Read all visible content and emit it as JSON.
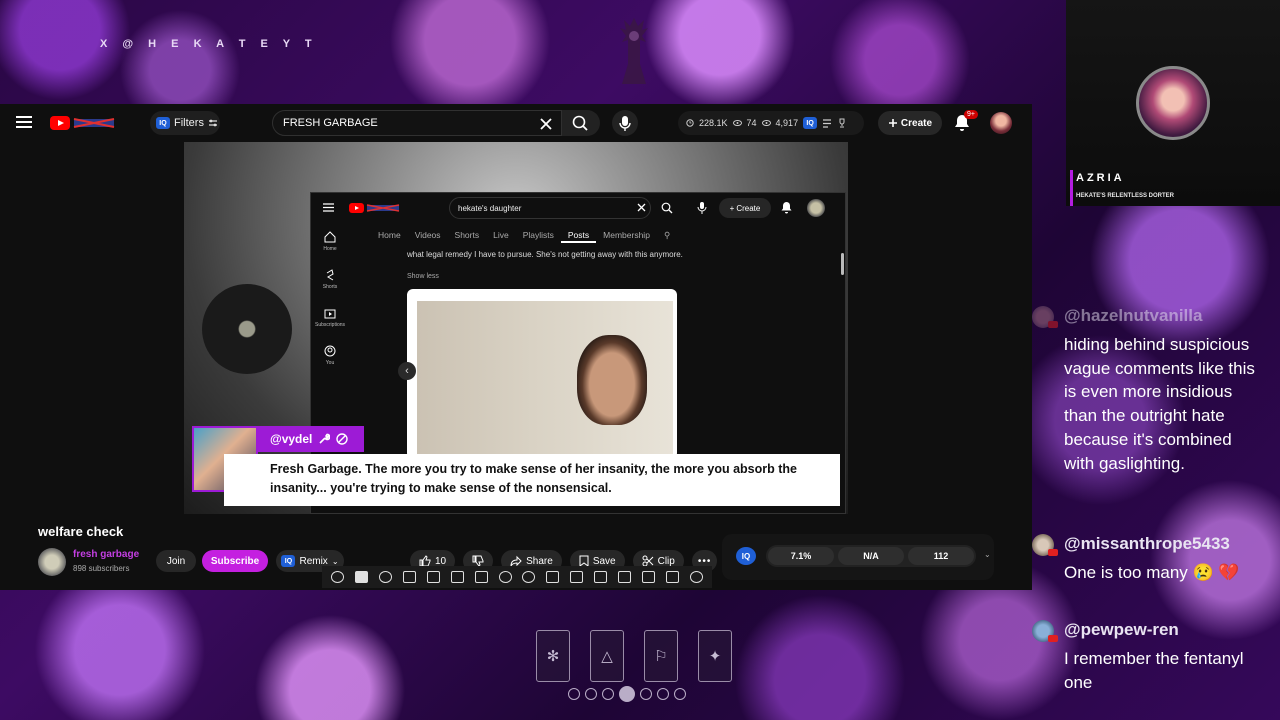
{
  "overlay": {
    "handle": "X @ H E K A T E Y T",
    "streamer_name": "AZRIA",
    "streamer_subtitle": "HEKATE'S RELENTLESS DORTER"
  },
  "topbar": {
    "filters_label": "Filters",
    "search_value": "FRESH GARBAGE",
    "stats": [
      "228.1K",
      "74",
      "4,917"
    ],
    "create_label": "Create",
    "notif_count": "9+"
  },
  "inner_page": {
    "search_value": "hekate's daughter",
    "create_label": "Create",
    "tabs": [
      "Home",
      "Videos",
      "Shorts",
      "Live",
      "Playlists",
      "Posts",
      "Membership"
    ],
    "sidebar": [
      "Home",
      "Shorts",
      "Subscriptions",
      "You"
    ],
    "post_text": "what legal remedy I have to pursue. She's not getting away with this anymore.",
    "show_less": "Show less"
  },
  "chat_overlay": {
    "username": "@vydel",
    "message": "Fresh Garbage. The more you try to make sense of her insanity, the more you absorb the insanity... you're trying to make sense of the nonsensical."
  },
  "video": {
    "title": "welfare check",
    "channel": "fresh garbage",
    "subscribers": "898 subscribers",
    "join_label": "Join",
    "subscribe_label": "Subscribe",
    "remix_label": "Remix",
    "likes": "10",
    "share_label": "Share",
    "save_label": "Save",
    "clip_label": "Clip"
  },
  "iq_panel": {
    "badge": "IQ",
    "metrics": [
      "7.1%",
      "N/A",
      "112"
    ]
  },
  "chat": [
    {
      "user": "@hazelnutvanilla",
      "text": "hiding behind suspicious vague comments like this is even more insidious than the outright hate because it's combined with gaslighting."
    },
    {
      "user": "@missanthrope5433",
      "text": "One is too many 😢 💔"
    },
    {
      "user": "@pewpew-ren",
      "text": "I remember the fentanyl one"
    }
  ],
  "colors": {
    "accent": "#c41fe0",
    "name_tag": "#9d1bd6",
    "youtube_red": "#ff0000"
  }
}
